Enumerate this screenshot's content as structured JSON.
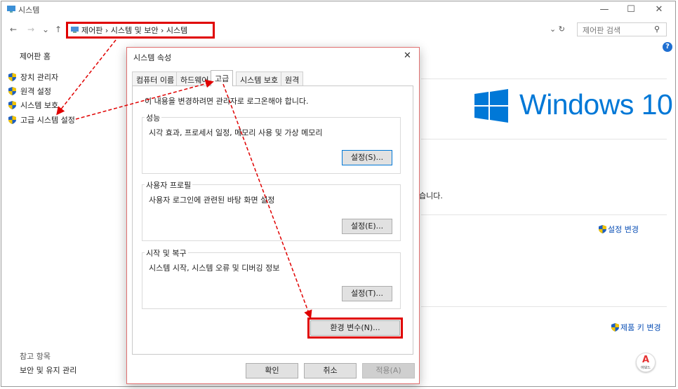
{
  "window": {
    "title": "시스템",
    "controls": {
      "minimize": "—",
      "maximize": "☐",
      "close": "✕"
    }
  },
  "nav": {
    "back": "←",
    "forward": "→",
    "dropdown": "⌄",
    "up": "↑",
    "breadcrumb": [
      "제어판",
      "시스템 및 보안",
      "시스템"
    ],
    "breadcrumb_text": "제어판 › 시스템 및 보안 › 시스템",
    "refresh": "⌄ ↻",
    "search_placeholder": "제어판 검색"
  },
  "left_pane": {
    "home": "제어판 홈",
    "items": [
      "장치 관리자",
      "원격 설정",
      "시스템 보호",
      "고급 시스템 설정"
    ],
    "see_also_title": "참고 항목",
    "see_also_items": [
      "보안 및 유지 관리"
    ]
  },
  "main": {
    "windows_logo_text": "Windows 10",
    "partial_text": "습니다.",
    "change_settings": "설정 변경",
    "change_product_key": "제품 키 변경"
  },
  "brand": {
    "letter": "A",
    "name": "아보느"
  },
  "dialog": {
    "title": "시스템 속성",
    "close": "✕",
    "tabs": [
      "컴퓨터 이름",
      "하드웨어",
      "고급",
      "시스템 보호",
      "원격"
    ],
    "active_tab": "고급",
    "admin_note": "이 내용을 변경하려면 관리자로 로그온해야 합니다.",
    "groups": [
      {
        "title": "성능",
        "description": "시각 효과, 프로세서 일정, 메모리 사용 및 가상 메모리",
        "button": "설정(S)..."
      },
      {
        "title": "사용자 프로필",
        "description": "사용자 로그인에 관련된 바탕 화면 설정",
        "button": "설정(E)..."
      },
      {
        "title": "시작 및 복구",
        "description": "시스템 시작, 시스템 오류 및 디버깅 정보",
        "button": "설정(T)..."
      }
    ],
    "env_button": "환경 변수(N)...",
    "ok": "확인",
    "cancel": "취소",
    "apply": "적용(A)"
  },
  "colors": {
    "highlight": "#e00000",
    "accent": "#0078d7",
    "link": "#0a4fb5"
  }
}
